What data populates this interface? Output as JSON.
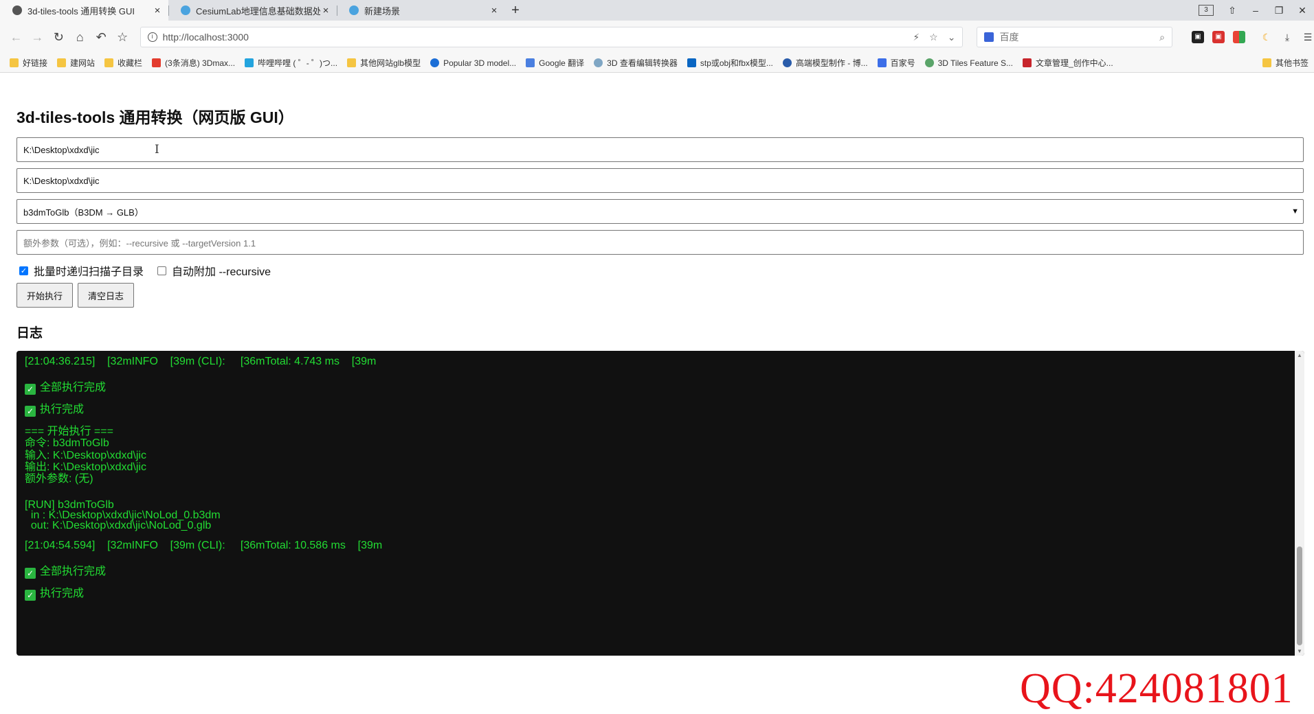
{
  "browser": {
    "tabs": [
      {
        "title": "3d-tiles-tools 通用转换 GUI",
        "close": "×"
      },
      {
        "title": "CesiumLab地理信息基础数据处",
        "close": "×"
      },
      {
        "title": "新建场景",
        "close": "×"
      }
    ],
    "new_tab": "+",
    "window_count": "3",
    "url": "http://localhost:3000",
    "search_placeholder": "百度",
    "bookmarks": [
      "好链接",
      "建网站",
      "收藏栏",
      "(3条消息) 3Dmax...",
      "哔哩哔哩 ( ゜- ゜)つ...",
      "其他网站glb模型",
      "Popular 3D model...",
      "Google 翻译",
      "3D 查看编辑转换器",
      "stp或obj和fbx模型...",
      "高端模型制作 - 博...",
      "百家号",
      "3D Tiles Feature S...",
      "文章管理_创作中心..."
    ],
    "other_bookmarks": "其他书签"
  },
  "page": {
    "title": "3d-tiles-tools 通用转换（网页版 GUI）",
    "input_path": "K:\\Desktop\\xdxd\\jic",
    "output_path": "K:\\Desktop\\xdxd\\jic",
    "command_select": "b3dmToGlb（B3DM → GLB）",
    "extra_args_placeholder": "额外参数（可选），例如：--recursive 或 --targetVersion 1.1",
    "check_recursive_label": "批量时递归扫描子目录",
    "check_recursive_checked": true,
    "check_auto_label": "自动附加 --recursive",
    "check_auto_checked": false,
    "start_button": "开始执行",
    "clear_button": "清空日志",
    "log_heading": "日志"
  },
  "log": {
    "lines": [
      "[21:04:36.215]    [32mINFO    [39m (CLI):     [36mTotal: 4.743 ms    [39m",
      "全部执行完成",
      "执行完成",
      "=== 开始执行 ===",
      "命令: b3dmToGlb",
      "输入: K:\\Desktop\\xdxd\\jic",
      "输出: K:\\Desktop\\xdxd\\jic",
      "额外参数: (无)",
      "[RUN] b3dmToGlb",
      "  in : K:\\Desktop\\xdxd\\jic\\NoLod_0.b3dm",
      "  out: K:\\Desktop\\xdxd\\jic\\NoLod_0.glb",
      "[21:04:54.594]    [32mINFO    [39m (CLI):     [36mTotal: 10.586 ms    [39m",
      "全部执行完成",
      "执行完成"
    ]
  },
  "watermark": "QQ:424081801",
  "colors": {
    "log_background": "#111111",
    "log_text": "#22dd33",
    "checkbox_accent": "#0075ff",
    "watermark": "#e8141b"
  }
}
